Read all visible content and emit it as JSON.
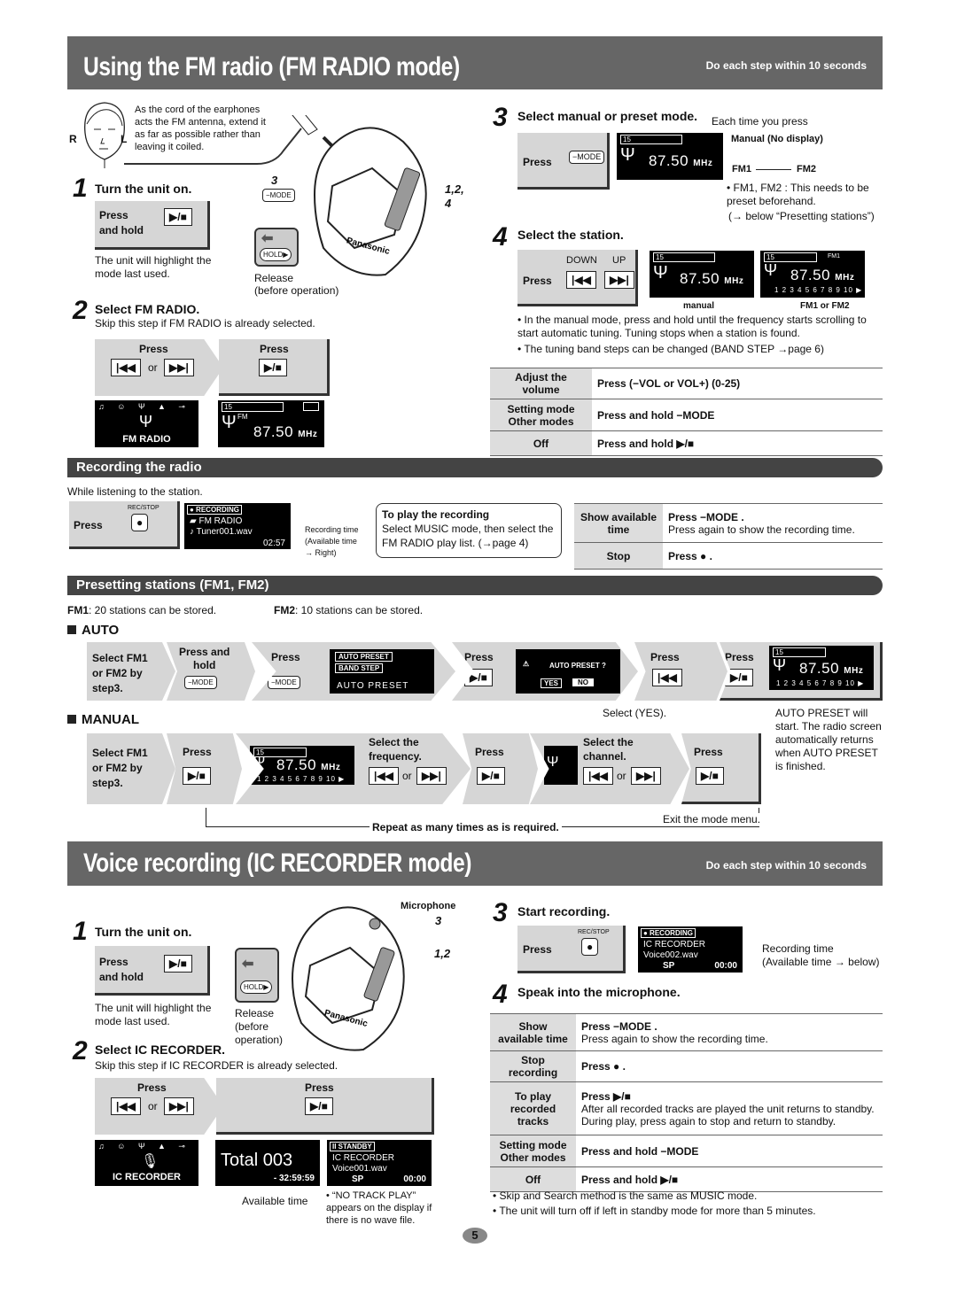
{
  "fm_section": {
    "title": "Using the FM radio (FM RADIO mode)",
    "subtitle": "Do each step within 10 seconds",
    "antenna_note": "As the cord of the earphones acts the FM antenna, extend it as far as possible rather than leaving it coiled.",
    "ear_labels": [
      "R",
      "L"
    ],
    "device_labels": {
      "mode_callout": "3",
      "side_callout": "1,2,\n4",
      "release": "Release",
      "before_op": "(before operation)",
      "hold": "HOLD▶",
      "brand": "Panasonic"
    },
    "step1": {
      "num": "1",
      "title": "Turn the unit on.",
      "action": "Press\nand hold",
      "key": "▶/■",
      "note": "The unit will highlight the mode last used."
    },
    "step2": {
      "num": "2",
      "title": "Select FM RADIO.",
      "note": "Skip this step if FM RADIO is already selected.",
      "press_a": "Press",
      "press_b": "Press",
      "prev": "|◀◀",
      "or": "or",
      "next": "▶▶|",
      "play": "▶/■",
      "lcd_a": "FM RADIO",
      "lcd_b_freq": "87.50",
      "mhz": "MHz",
      "fm": "FM",
      "vol": "15"
    },
    "step3": {
      "num": "3",
      "title": "Select manual or preset mode.",
      "press": "Press",
      "mode_key": "−MODE",
      "each_time": "Each time you press",
      "manual": "Manual (No display)",
      "fm1": "FM1",
      "fm2": "FM2",
      "note1": "• FM1, FM2 : This needs to be preset beforehand.",
      "note2": "(→ below “Presetting stations”)",
      "freq": "87.50"
    },
    "step4": {
      "num": "4",
      "title": "Select the station.",
      "press": "Press",
      "down": "DOWN",
      "up": "UP",
      "cap_manual": "manual",
      "cap_preset": "FM1 or FM2",
      "bullets": [
        "• In the manual mode, press and hold until the frequency starts scrolling to start automatic tuning. Tuning stops when a station is found.",
        "• The tuning band steps can be changed (BAND STEP →page 6)"
      ],
      "freq": "87.50",
      "fm1tag": "FM1"
    },
    "table": [
      {
        "label": "Adjust the volume",
        "value": "Press (−VOL or VOL+) (0-25)"
      },
      {
        "label": "Setting mode\nOther modes",
        "value": "Press and hold −MODE"
      },
      {
        "label": "Off",
        "value": "Press and hold ▶/■"
      }
    ]
  },
  "recording": {
    "header": "Recording the radio",
    "intro": "While listening to the station.",
    "press": "Press",
    "recstop": "REC/STOP",
    "lcd": {
      "status": "● RECORDING",
      "folder": "FM RADIO",
      "file": "Tuner001.wav",
      "time": "02:57"
    },
    "rec_time_note": "Recording time\n(Available time\n→ Right)",
    "callout_title": "To play the recording",
    "callout_body": "Select MUSIC mode, then select the FM RADIO play list. (→page 4)",
    "table": [
      {
        "label": "Show available time",
        "value": "Press −MODE .",
        "value2": "Press again to show the recording time."
      },
      {
        "label": "Stop",
        "value": "Press ● ."
      }
    ]
  },
  "presetting": {
    "header": "Presetting stations (FM1, FM2)",
    "fm1_label": "FM1",
    "fm1_text": ": 20 stations can be stored.",
    "fm2_label": "FM2",
    "fm2_text": ": 10 stations can be stored.",
    "auto": {
      "title": "AUTO",
      "steps": [
        "Select FM1\nor FM2 by\nstep3.",
        "Press and\nhold",
        "Press",
        "Press",
        "Press",
        "Press"
      ],
      "lcd_menu": [
        "AUTO PRESET",
        "BAND STEP",
        "AUTO PRESET"
      ],
      "confirm": "AUTO PRESET ?",
      "yes": "YES",
      "no": "NO",
      "select_yes": "Select (YES).",
      "finish_note": "AUTO PRESET will start. The radio screen automatically returns when AUTO PRESET is finished."
    },
    "manual": {
      "title": "MANUAL",
      "steps": [
        "Select FM1\nor FM2 by\nstep3.",
        "Press",
        "Select the\nfrequency.",
        "Press",
        "Select the\nchannel.",
        "Press"
      ],
      "repeat": "Repeat as many times as is required.",
      "exit": "Exit the mode menu.",
      "or": "or"
    }
  },
  "ic_section": {
    "title": "Voice recording (IC RECORDER mode)",
    "subtitle": "Do each step within 10 seconds",
    "device_labels": {
      "microphone": "Microphone",
      "c3": "3",
      "c12": "1,2",
      "release": "Release\n(before\noperation)",
      "hold": "HOLD▶",
      "brand": "Panasonic"
    },
    "step1": {
      "num": "1",
      "title": "Turn the unit on.",
      "action": "Press\nand hold",
      "key": "▶/■",
      "note": "The unit will highlight the mode last used."
    },
    "step2": {
      "num": "2",
      "title": "Select IC RECORDER.",
      "note": "Skip this step if IC RECORDER is already selected.",
      "press_a": "Press",
      "press_b": "Press",
      "lcd_a": "IC RECORDER",
      "lcd_total": "Total 003",
      "lcd_avail": "- 32:59:59",
      "avail_label": "Available time",
      "standby": "II STANDBY",
      "standby_folder": "IC RECORDER",
      "standby_file": "Voice001.wav",
      "standby_sp": "SP",
      "standby_time": "00:00",
      "no_track_note": "• “NO TRACK PLAY” appears on the display if there is no wave file."
    },
    "step3": {
      "num": "3",
      "title": "Start recording.",
      "press": "Press",
      "recstop": "REC/STOP",
      "lcd_status": "● RECORDING",
      "lcd_folder": "IC RECORDER",
      "lcd_file": "Voice002.wav",
      "lcd_sp": "SP",
      "lcd_time": "00:00",
      "note": "Recording time\n(Available time → below)"
    },
    "step4": {
      "num": "4",
      "title": "Speak into the microphone."
    },
    "table": [
      {
        "label": "Show\navailable time",
        "value": "Press −MODE .",
        "value2": "Press again to show the recording time."
      },
      {
        "label": "Stop recording",
        "value": "Press ● ."
      },
      {
        "label": "To play\nrecorded\ntracks",
        "value": "Press ▶/■",
        "value2": "After all recorded tracks are played the unit returns to standby.\nDuring play, press again to stop and return to standby."
      },
      {
        "label": "Setting mode\nOther modes",
        "value": "Press and hold −MODE"
      },
      {
        "label": "Off",
        "value": "Press and hold ▶/■"
      }
    ],
    "bullets": [
      "• Skip and Search method is the same as MUSIC mode.",
      "• The unit will turn off if left in standby mode for more than 5 minutes."
    ]
  },
  "page_number": "5"
}
